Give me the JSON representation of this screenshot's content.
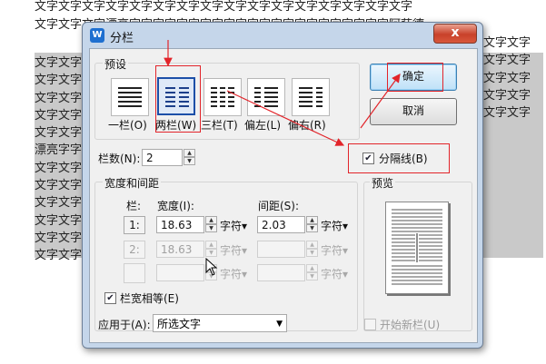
{
  "document": {
    "line1": "文字文字文字文字文字文字文字文字文字文字文字文字文字文字文字文字",
    "line2": "文字文字文字漂亮字字字字字字字字字字字字字字字字字字字字字字阿萨德。",
    "left_rows": [
      "文字文字",
      "文字文字",
      "文字文字",
      "文字文字",
      "文字文字",
      "漂亮字字",
      "文字文字",
      "文字文字",
      "文字文字",
      "文字文字",
      "文字文字",
      "文字文字"
    ],
    "right_rows": [
      "文字文字",
      "文字文字",
      "文字文字",
      "文字文字",
      "文字文字"
    ]
  },
  "dialog": {
    "title": "分栏",
    "app_icon_letter": "W",
    "close_symbol": "x",
    "ok_label": "确定",
    "cancel_label": "取消",
    "presets_group": "预设",
    "presets": [
      {
        "label": "一栏(O)",
        "cols": 1
      },
      {
        "label": "两栏(W)",
        "cols": 2
      },
      {
        "label": "三栏(T)",
        "cols": 3
      },
      {
        "label": "偏左(L)",
        "cols": 2
      },
      {
        "label": "偏右(R)",
        "cols": 2
      }
    ],
    "selected_preset": "两栏(W)",
    "col_count_label": "栏数(N):",
    "col_count_value": "2",
    "divider_label": "分隔线(B)",
    "divider_checked": true,
    "width_spacing_group": "宽度和间距",
    "col_header": "栏:",
    "width_header": "宽度(I):",
    "spacing_header": "间距(S):",
    "rows": [
      {
        "num": "1:",
        "width": "18.63",
        "spacing": "2.03",
        "enabled": true
      },
      {
        "num": "2:",
        "width": "18.63",
        "spacing": "",
        "enabled": false
      },
      {
        "num": "",
        "width": "",
        "spacing": "",
        "enabled": false
      }
    ],
    "unit_label": "字符",
    "equal_width_label": "栏宽相等(E)",
    "equal_width_checked": true,
    "preview_group": "预览",
    "apply_to_label": "应用于(A):",
    "apply_to_value": "所选文字",
    "new_column_label": "开始新栏(U)",
    "new_column_checked": false,
    "check_mark": "✔"
  },
  "colors": {
    "accent": "#1c4fa8",
    "annotation_red": "#e2242a",
    "selection_gray": "#c9c9c9",
    "title_bar": "#c5d6ea"
  }
}
